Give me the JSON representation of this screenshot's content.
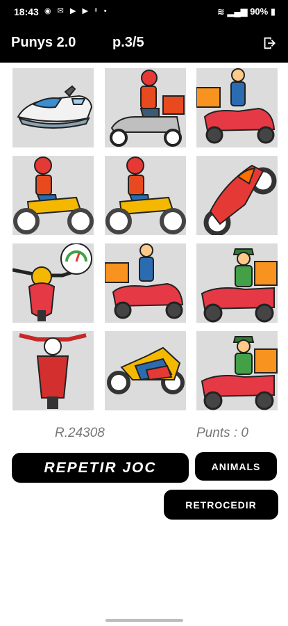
{
  "status_bar": {
    "time": "18:43",
    "notification_icons": [
      "messenger-icon",
      "gmail-icon",
      "youtube-icon",
      "youtube-icon",
      "cellular-signal-icon",
      "dot-icon"
    ],
    "battery": "90%"
  },
  "app_bar": {
    "title": "Punys 2.0",
    "page": "p.3/5",
    "exit_icon": "exit-to-app-icon"
  },
  "grid": {
    "tiles": [
      {
        "icon": "jet-ski-icon"
      },
      {
        "icon": "delivery-scooter-helmet-icon"
      },
      {
        "icon": "delivery-scooter-icon"
      },
      {
        "icon": "motorcycle-rider-icon"
      },
      {
        "icon": "motorcycle-rider-icon"
      },
      {
        "icon": "sport-motorbike-wheelie-icon"
      },
      {
        "icon": "scooter-speedometer-icon"
      },
      {
        "icon": "delivery-scooter-icon"
      },
      {
        "icon": "delivery-scooter-cap-icon"
      },
      {
        "icon": "scooter-front-icon"
      },
      {
        "icon": "sport-motorbike-icon"
      },
      {
        "icon": "delivery-scooter-cap-icon"
      }
    ]
  },
  "footer": {
    "record": "R.24308",
    "points": "Punts : 0"
  },
  "buttons": {
    "repeat": "REPETIR JOC",
    "animals": "ANIMALS",
    "back": "RETROCEDIR"
  },
  "colors": {
    "app_bar": "#000000",
    "tile_background": "#dcdcdc",
    "button_background": "#000000",
    "info_text": "#777777"
  }
}
